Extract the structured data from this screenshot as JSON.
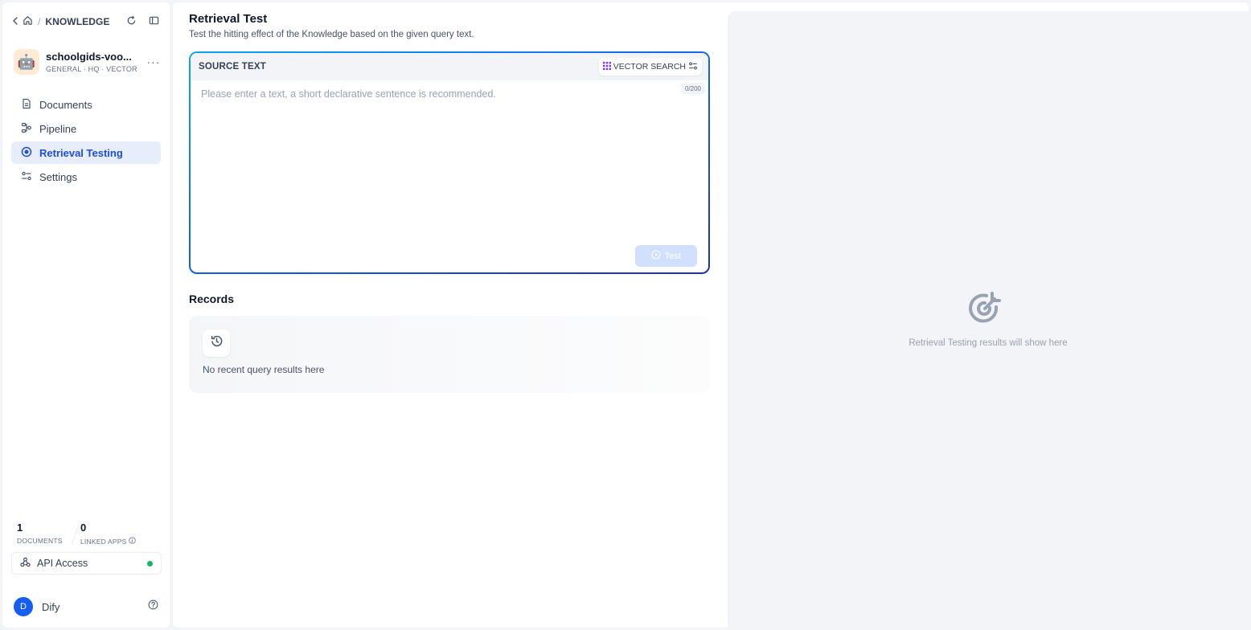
{
  "sidebar": {
    "breadcrumb": {
      "section": "KNOWLEDGE"
    },
    "knowledge": {
      "name": "schoolgids-voo...",
      "meta": "GENERAL · HQ · VECTOR",
      "more": "···"
    },
    "nav": [
      {
        "label": "Documents",
        "icon": "document-icon"
      },
      {
        "label": "Pipeline",
        "icon": "pipeline-icon"
      },
      {
        "label": "Retrieval Testing",
        "icon": "target-icon",
        "active": true
      },
      {
        "label": "Settings",
        "icon": "settings-icon"
      }
    ],
    "stats": {
      "documents_count": "1",
      "documents_label": "DOCUMENTS",
      "apps_count": "0",
      "apps_label": "LINKED APPS"
    },
    "api": {
      "label": "API Access",
      "status_color": "#12b76a"
    },
    "user": {
      "initial": "D",
      "name": "Dify"
    }
  },
  "main": {
    "title": "Retrieval Test",
    "subtitle": "Test the hitting effect of the Knowledge based on the given query text.",
    "query": {
      "header_label": "SOURCE TEXT",
      "search_mode": "VECTOR SEARCH",
      "counter": "0/200",
      "value": "",
      "placeholder": "Please enter a text, a short declarative sentence is recommended.",
      "test_label": "Test"
    },
    "records": {
      "title": "Records",
      "empty_text": "No recent query results here"
    },
    "results": {
      "empty_text": "Retrieval Testing results will show here"
    }
  },
  "colors": {
    "accent": "#155eef",
    "active_nav_bg": "#e8edfb",
    "test_button_disabled": "#d1e0ff"
  }
}
